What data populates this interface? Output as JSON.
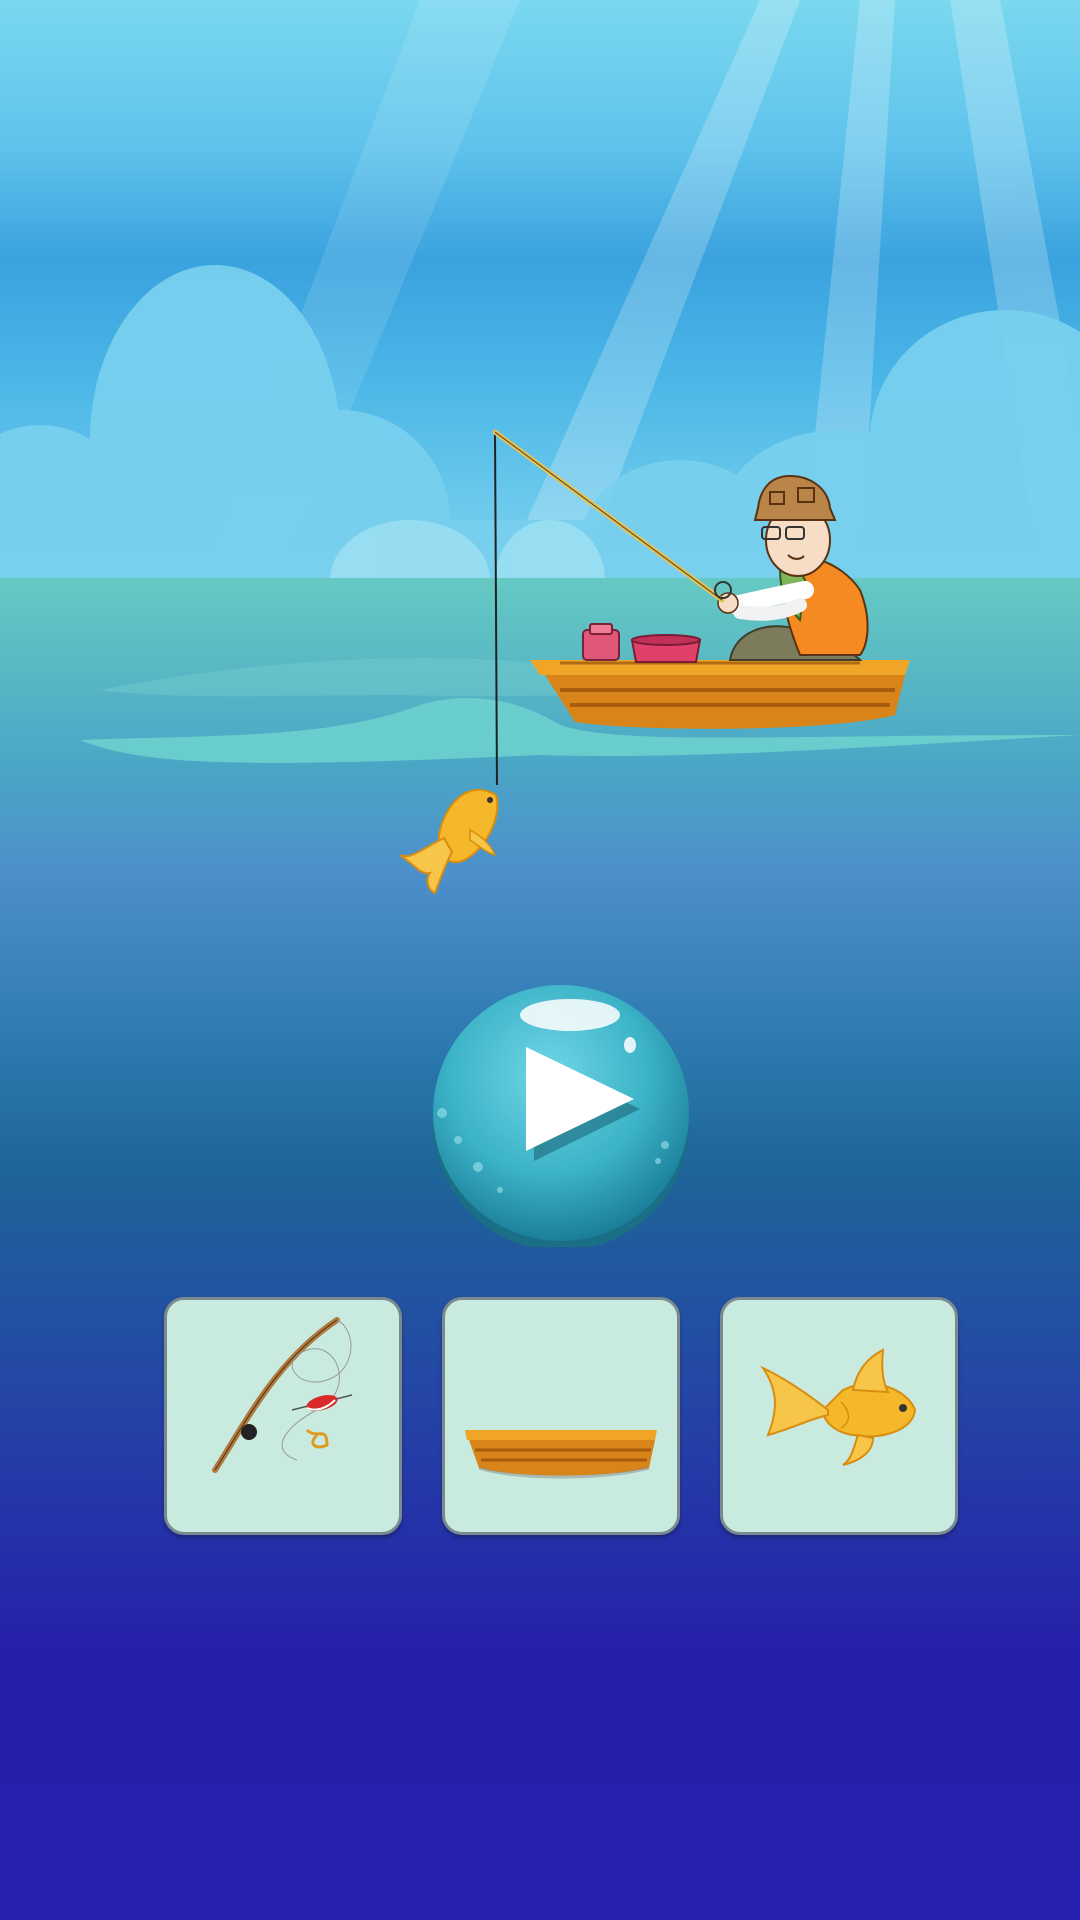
{
  "scene": {
    "icons": [
      "sun-rays-icon",
      "cloud-icon",
      "fisherman-icon",
      "fishing-rod-icon",
      "boat-icon",
      "bucket-icon",
      "thermos-icon",
      "goldfish-icon"
    ]
  },
  "play_button": {
    "icon": "play-icon",
    "label": ""
  },
  "item_cards": [
    {
      "name": "fishing-rod",
      "icon": "fishing-rod-icon"
    },
    {
      "name": "boat",
      "icon": "boat-icon"
    },
    {
      "name": "goldfish",
      "icon": "goldfish-icon"
    }
  ],
  "colors": {
    "sky_top": "#7ad8ef",
    "sea_deep": "#2520a9",
    "card_bg": "#c8eadf",
    "card_border": "#7a8a8f",
    "play_button": "#3cb3c7",
    "fish": "#f5b82a",
    "boat": "#e59a1f"
  }
}
